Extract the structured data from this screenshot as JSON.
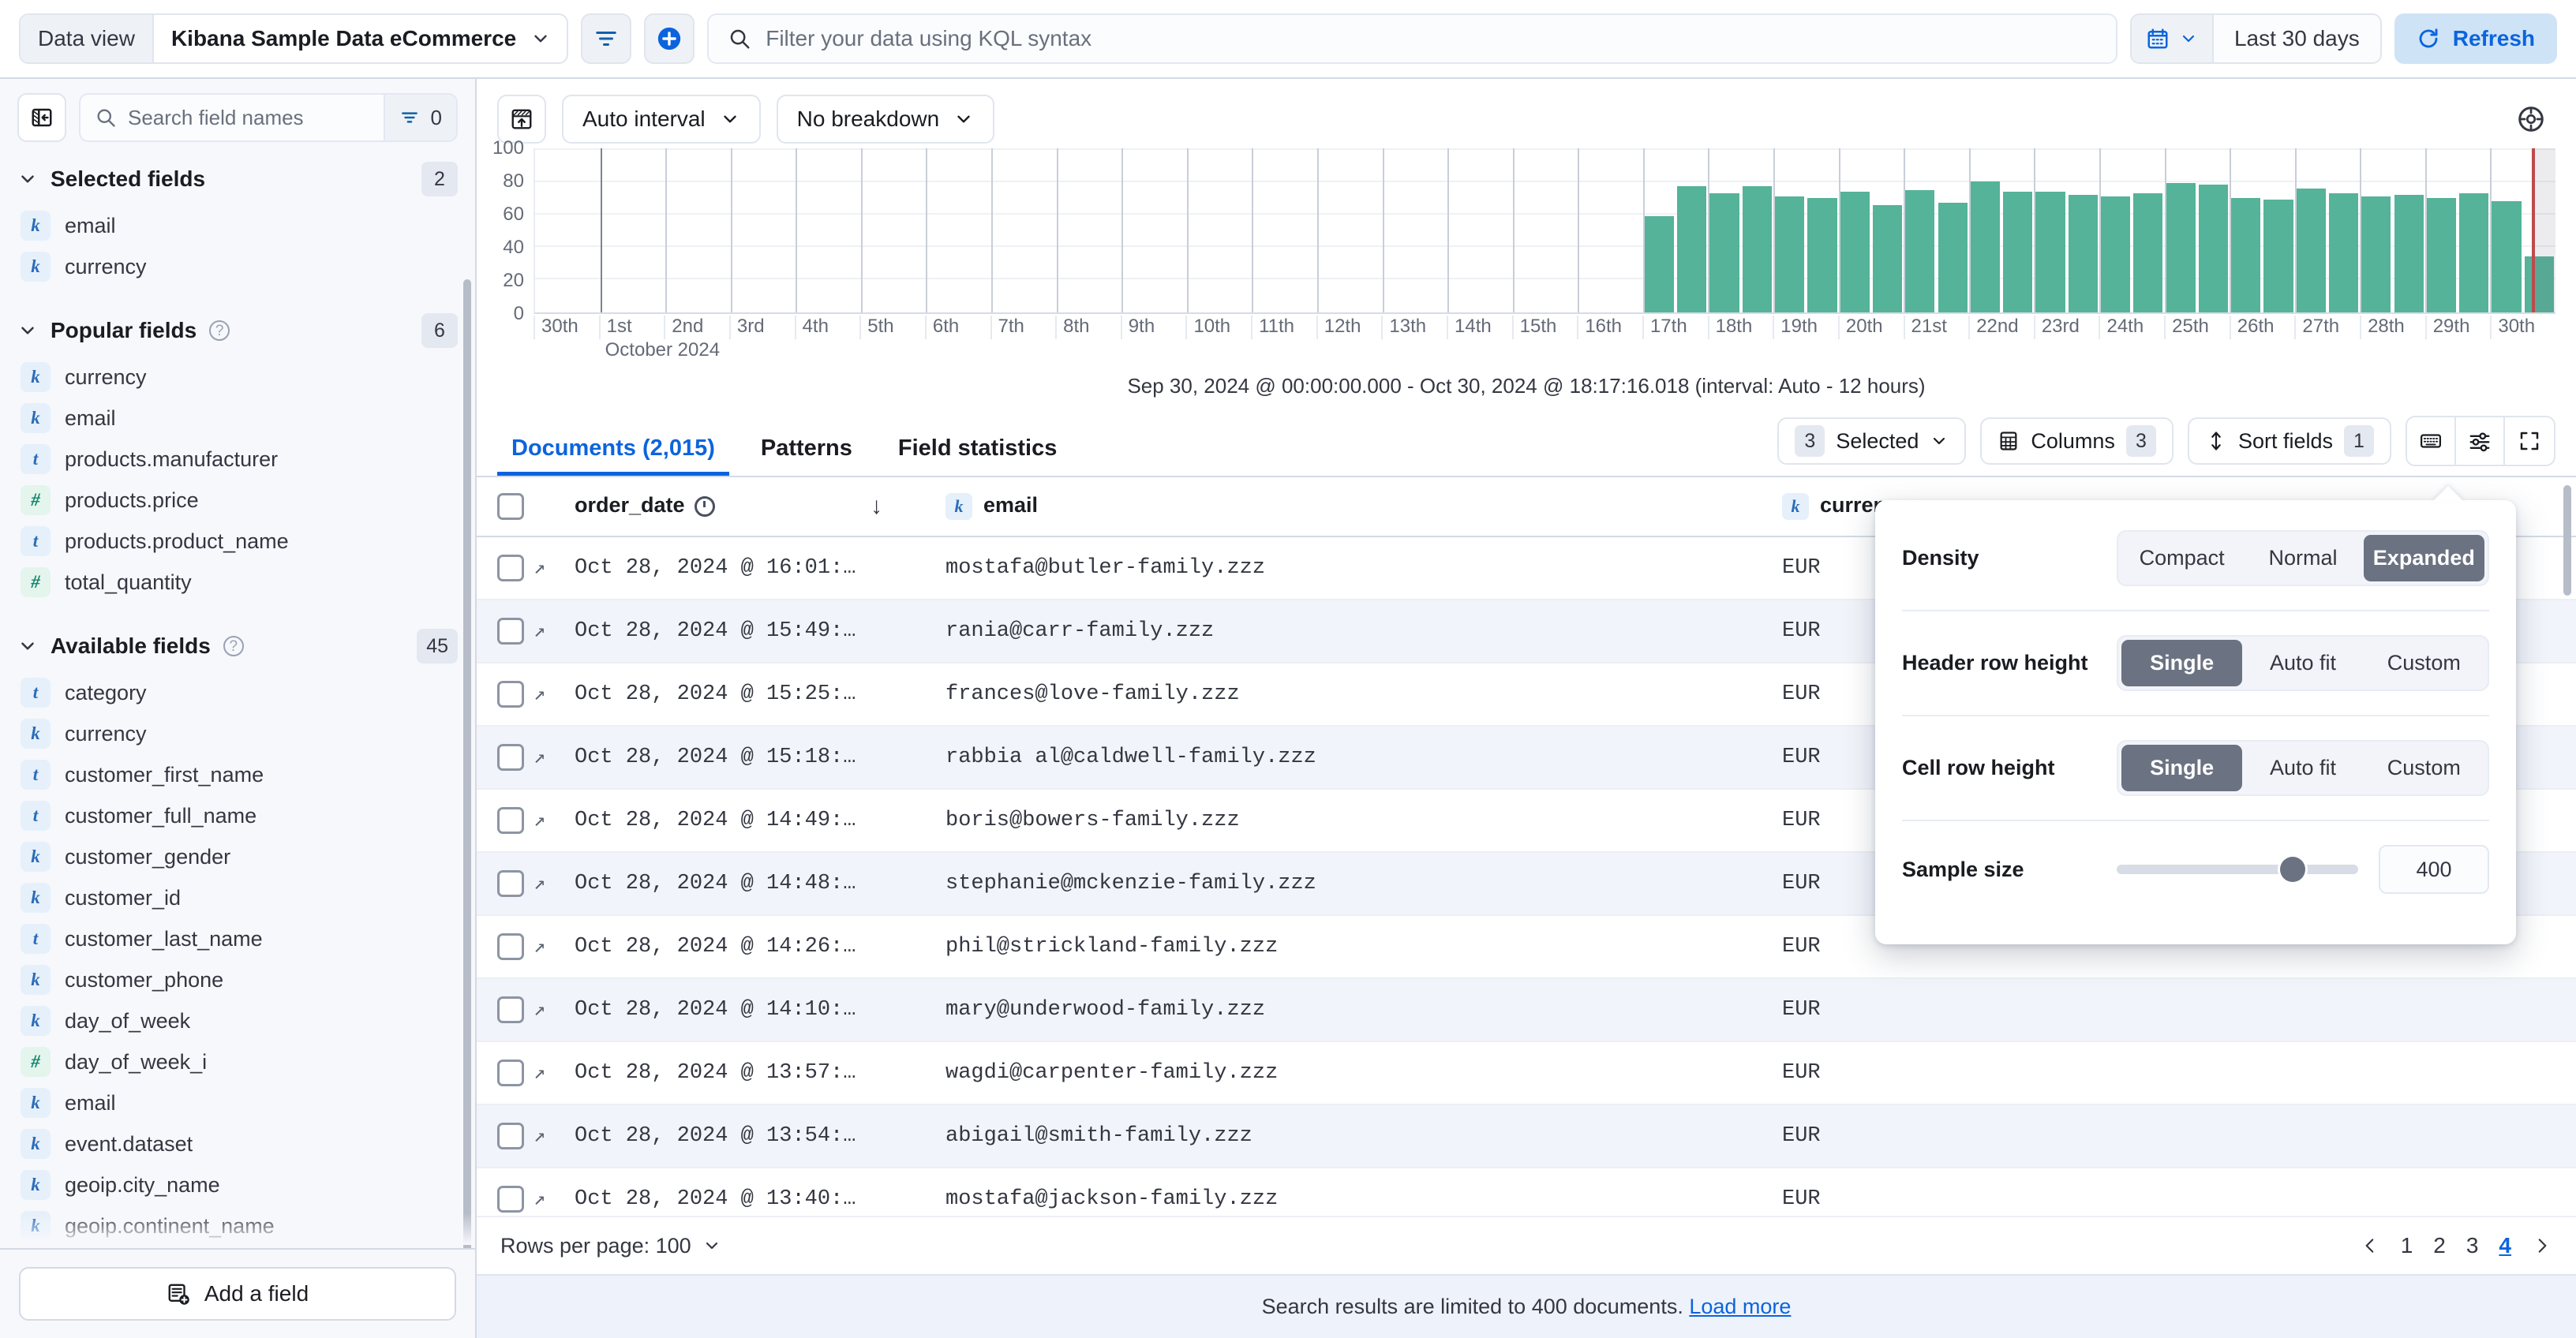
{
  "topbar": {
    "data_view_label": "Data view",
    "data_view_value": "Kibana Sample Data eCommerce",
    "filter_icon": "filter-icon",
    "add_filter_icon": "add-filter-icon",
    "search_placeholder": "Filter your data using KQL syntax",
    "date_range": "Last 30 days",
    "refresh_label": "Refresh"
  },
  "sidebar": {
    "search_placeholder": "Search field names",
    "filter_count": "0",
    "groups": [
      {
        "title": "Selected fields",
        "count": "2",
        "has_help": false,
        "fields": [
          {
            "type": "k",
            "name": "email"
          },
          {
            "type": "k",
            "name": "currency"
          }
        ]
      },
      {
        "title": "Popular fields",
        "count": "6",
        "has_help": true,
        "fields": [
          {
            "type": "k",
            "name": "currency"
          },
          {
            "type": "k",
            "name": "email"
          },
          {
            "type": "t",
            "name": "products.manufacturer"
          },
          {
            "type": "n",
            "name": "products.price"
          },
          {
            "type": "t",
            "name": "products.product_name"
          },
          {
            "type": "n",
            "name": "total_quantity"
          }
        ]
      },
      {
        "title": "Available fields",
        "count": "45",
        "has_help": true,
        "fields": [
          {
            "type": "t",
            "name": "category"
          },
          {
            "type": "k",
            "name": "currency"
          },
          {
            "type": "t",
            "name": "customer_first_name"
          },
          {
            "type": "t",
            "name": "customer_full_name"
          },
          {
            "type": "k",
            "name": "customer_gender"
          },
          {
            "type": "k",
            "name": "customer_id"
          },
          {
            "type": "t",
            "name": "customer_last_name"
          },
          {
            "type": "k",
            "name": "customer_phone"
          },
          {
            "type": "k",
            "name": "day_of_week"
          },
          {
            "type": "n",
            "name": "day_of_week_i"
          },
          {
            "type": "k",
            "name": "email"
          },
          {
            "type": "k",
            "name": "event.dataset"
          },
          {
            "type": "k",
            "name": "geoip.city_name"
          },
          {
            "type": "k",
            "name": "geoip.continent_name"
          }
        ]
      }
    ],
    "add_field_label": "Add a field"
  },
  "chart": {
    "edit_visualization_icon": "edit-visualization-icon",
    "interval_label": "Auto interval",
    "breakdown_label": "No breakdown",
    "chart_options_icon": "chart-options-icon",
    "time_range_label": "Sep 30, 2024 @ 00:00:00.000 - Oct 30, 2024 @ 18:17:16.018 (interval: Auto - 12 hours)"
  },
  "chart_data": {
    "type": "bar",
    "title": "",
    "xlabel": "October 2024",
    "ylabel": "",
    "ylim": [
      0,
      100
    ],
    "yticks": [
      0,
      20,
      40,
      60,
      80,
      100
    ],
    "grid": true,
    "legend": "none",
    "interval": "Auto - 12 hours",
    "xtick_labels": [
      "30th",
      "1st",
      "2nd",
      "3rd",
      "4th",
      "5th",
      "6th",
      "7th",
      "8th",
      "9th",
      "10th",
      "11th",
      "12th",
      "13th",
      "14th",
      "15th",
      "16th",
      "17th",
      "18th",
      "19th",
      "20th",
      "21st",
      "22nd",
      "23rd",
      "24th",
      "25th",
      "26th",
      "27th",
      "28th",
      "29th",
      "30th"
    ],
    "xtick_sublabel": "October 2024",
    "bar_color": "#54b399",
    "now_marker_color": "#bd4a4a",
    "categories": [
      "Oct 17 AM",
      "Oct 17 PM",
      "Oct 18 AM",
      "Oct 18 PM",
      "Oct 19 AM",
      "Oct 19 PM",
      "Oct 20 AM",
      "Oct 20 PM",
      "Oct 21 AM",
      "Oct 21 PM",
      "Oct 22 AM",
      "Oct 22 PM",
      "Oct 23 AM",
      "Oct 23 PM",
      "Oct 24 AM",
      "Oct 24 PM",
      "Oct 25 AM",
      "Oct 25 PM",
      "Oct 26 AM",
      "Oct 26 PM",
      "Oct 27 AM",
      "Oct 27 PM",
      "Oct 28 AM",
      "Oct 28 PM",
      "Oct 29 AM",
      "Oct 29 PM",
      "Oct 30 AM",
      "Oct 30 PM"
    ],
    "values": [
      58,
      76,
      72,
      76,
      70,
      69,
      73,
      65,
      74,
      66,
      79,
      73,
      73,
      71,
      70,
      72,
      78,
      77,
      69,
      68,
      75,
      72,
      70,
      71,
      69,
      72,
      67,
      34
    ]
  },
  "results": {
    "tabs": [
      {
        "label": "Documents (2,015)",
        "active": true
      },
      {
        "label": "Patterns",
        "active": false
      },
      {
        "label": "Field statistics",
        "active": false
      }
    ],
    "selected_label": "Selected",
    "selected_count": "3",
    "columns_label": "Columns",
    "columns_count": "3",
    "sort_label": "Sort fields",
    "sort_count": "1",
    "keyboard_icon": "keyboard-shortcuts-icon",
    "display_options_icon": "display-options-icon",
    "fullscreen_icon": "fullscreen-icon",
    "table": {
      "headers": [
        "order_date",
        "email",
        "currency"
      ],
      "header_date_sort_icon": "sort-descending-icon",
      "rows": [
        {
          "date": "Oct 28, 2024 @ 16:01:…",
          "email": "mostafa@butler-family.zzz",
          "currency": "EUR"
        },
        {
          "date": "Oct 28, 2024 @ 15:49:…",
          "email": "rania@carr-family.zzz",
          "currency": "EUR"
        },
        {
          "date": "Oct 28, 2024 @ 15:25:…",
          "email": "frances@love-family.zzz",
          "currency": "EUR"
        },
        {
          "date": "Oct 28, 2024 @ 15:18:…",
          "email": "rabbia al@caldwell-family.zzz",
          "currency": "EUR"
        },
        {
          "date": "Oct 28, 2024 @ 14:49:…",
          "email": "boris@bowers-family.zzz",
          "currency": "EUR"
        },
        {
          "date": "Oct 28, 2024 @ 14:48:…",
          "email": "stephanie@mckenzie-family.zzz",
          "currency": "EUR"
        },
        {
          "date": "Oct 28, 2024 @ 14:26:…",
          "email": "phil@strickland-family.zzz",
          "currency": "EUR"
        },
        {
          "date": "Oct 28, 2024 @ 14:10:…",
          "email": "mary@underwood-family.zzz",
          "currency": "EUR"
        },
        {
          "date": "Oct 28, 2024 @ 13:57:…",
          "email": "wagdi@carpenter-family.zzz",
          "currency": "EUR"
        },
        {
          "date": "Oct 28, 2024 @ 13:54:…",
          "email": "abigail@smith-family.zzz",
          "currency": "EUR"
        },
        {
          "date": "Oct 28, 2024 @ 13:40:…",
          "email": "mostafa@jackson-family.zzz",
          "currency": "EUR"
        }
      ]
    },
    "rows_per_page_label": "Rows per page: 100",
    "pages": [
      "1",
      "2",
      "3",
      "4"
    ],
    "active_page": "4",
    "limit_text": "Search results are limited to 400 documents.",
    "load_more_label": "Load more"
  },
  "display_popover": {
    "density_label": "Density",
    "density_options": [
      "Compact",
      "Normal",
      "Expanded"
    ],
    "density_selected": "Expanded",
    "header_row_height_label": "Header row height",
    "header_row_height_options": [
      "Single",
      "Auto fit",
      "Custom"
    ],
    "header_row_height_selected": "Single",
    "cell_row_height_label": "Cell row height",
    "cell_row_height_options": [
      "Single",
      "Auto fit",
      "Custom"
    ],
    "cell_row_height_selected": "Single",
    "sample_size_label": "Sample size",
    "sample_size_value": "400"
  }
}
